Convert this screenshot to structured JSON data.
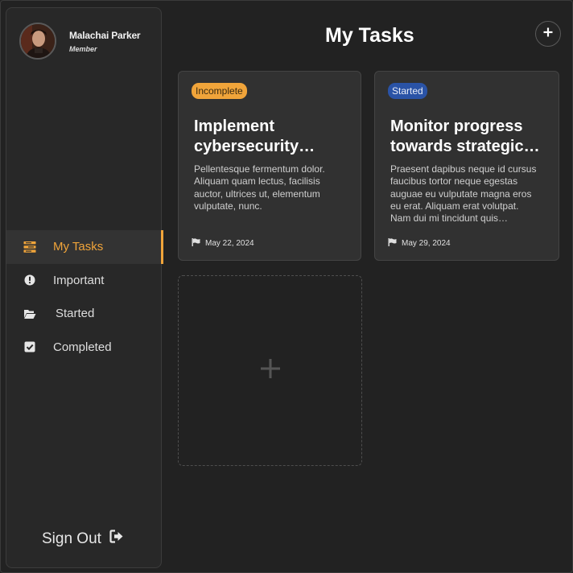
{
  "user": {
    "name": "Malachai Parker",
    "role": "Member"
  },
  "nav": {
    "items": [
      {
        "label": "My Tasks",
        "icon": "tasks-icon",
        "active": true
      },
      {
        "label": "Important",
        "icon": "exclamation-icon",
        "active": false
      },
      {
        "label": "Started",
        "icon": "folder-open-icon",
        "active": false
      },
      {
        "label": "Completed",
        "icon": "checkbox-icon",
        "active": false
      }
    ],
    "sign_out": "Sign Out"
  },
  "header": {
    "title": "My Tasks",
    "add_icon": "plus-icon"
  },
  "tasks": [
    {
      "status": "Incomplete",
      "title": "Implement cybersecurity…",
      "description": "Pellentesque fermentum dolor. Aliquam quam lectus, facilisis auctor, ultrices ut, elementum vulputate, nunc.",
      "date": "May 22, 2024"
    },
    {
      "status": "Started",
      "title": "Monitor progress towards strategic…",
      "description": "Praesent dapibus neque id cursus faucibus tortor neque egestas auguae eu vulputate magna eros eu erat. Aliquam erat volutpat. Nam dui mi tincidunt quis…",
      "date": "May 29, 2024"
    }
  ],
  "colors": {
    "accent": "#f0a43a",
    "started_badge": "#2a53a6",
    "background": "#222222",
    "card": "#313131"
  }
}
